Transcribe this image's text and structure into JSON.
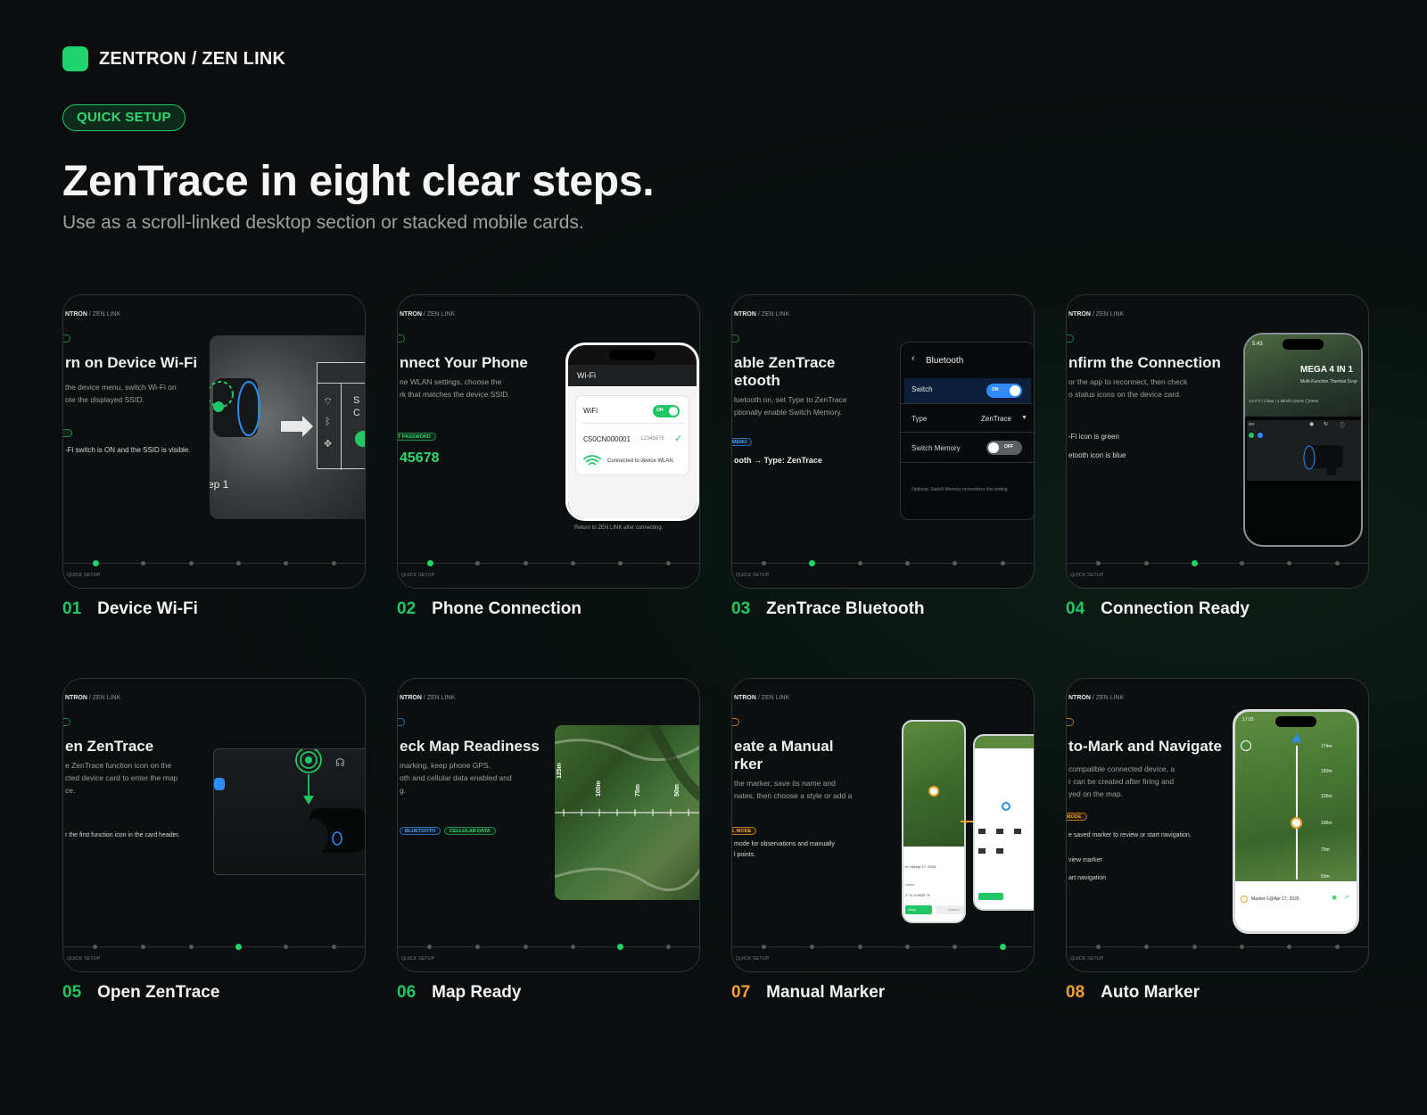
{
  "header": {
    "brand": "ZENTRON / ZEN LINK",
    "pill": "QUICK SETUP",
    "title": "ZenTrace in eight clear steps.",
    "subtitle": "Use as a scroll-linked desktop section or stacked mobile cards."
  },
  "common": {
    "brand_short": "NTRON",
    "brand_link": "/ ZEN LINK",
    "footer": "QUICK SETUP"
  },
  "colors": {
    "accent_green": "#22c765",
    "accent_orange": "#f0a030",
    "bluetooth_blue": "#2f8bf5",
    "background": "#0b0d0e"
  },
  "cards": [
    {
      "num": "01",
      "label": "Device Wi-Fi",
      "active_step": 1,
      "title": "rn on Device Wi-Fi",
      "desc": "the device menu, switch Wi-Fi on\note the displayed SSID.",
      "note": "-Fi switch is ON and the SSID is visible.",
      "panel_text": "ep 1",
      "menu_letters": [
        "S",
        "C"
      ]
    },
    {
      "num": "02",
      "label": "Phone Connection",
      "active_step": 2,
      "title": "nnect Your Phone",
      "desc": "ne WLAN settings, choose the\nrk that matches the device SSID.",
      "tag": "T PASSWORD",
      "password": "45678",
      "phone": {
        "header": "Wi-Fi",
        "wifi_label": "WiFi",
        "toggle": "ON",
        "ssid": "C50CN000001",
        "ssid_code": "12345678",
        "connected": "Connected to device WLAN"
      },
      "note": "Return to ZEN LINK after connecting."
    },
    {
      "num": "03",
      "label": "ZenTrace Bluetooth",
      "active_step": 3,
      "title": "able ZenTrace\netooth",
      "desc": "luetooth on, set Type to ZenTrace\nptionally enable Switch Memory.",
      "tag": "MENU",
      "path_from": "ooth",
      "path_to": "Type: ZenTrace",
      "panel": {
        "header": "Bluetooth",
        "switch_label": "Switch",
        "switch_state": "ON",
        "type_label": "Type",
        "type_value": "ZenTrace",
        "memory_label": "Switch Memory",
        "memory_state": "OFF",
        "footnote": "Optional: Switch Memory remembers this setting."
      }
    },
    {
      "num": "04",
      "label": "Connection Ready",
      "active_step": 4,
      "title": "nfirm the Connection",
      "desc": "or the app to reconnect, then check\no status icons on the device card.",
      "check1": "-Fi icon is green",
      "check2": "etooth icon is blue",
      "phone": {
        "time": "5:43",
        "banner_title": "MEGA 4 IN 1",
        "banner_sub": "Multi-Function Thermal Scop",
        "stats": "14.3°C / Clear   ↑1.2km/h   ◷31%   ◯0mm",
        "device_label": "iev"
      }
    },
    {
      "num": "05",
      "label": "Open ZenTrace",
      "active_step": 5,
      "title": "en ZenTrace",
      "desc": "e ZenTrace function icon on the\ncted device card to enter the map\nce.",
      "note": "r the first function icon in the card header."
    },
    {
      "num": "06",
      "label": "Map Ready",
      "active_step": 6,
      "title": "eck Map Readiness",
      "desc": "marking, keep phone GPS,\noth and cellular data enabled and\ng.",
      "tags": [
        "BLUETOOTH",
        "CELLULAR DATA"
      ],
      "ranges": [
        "125m",
        "100m",
        "75m",
        "50m"
      ]
    },
    {
      "num": "07",
      "label": "Manual Marker",
      "active_step": 7,
      "title": "eate a Manual\nrker",
      "desc": "the marker, save its name and\nnates, then choose a style or add a",
      "tag": "L MODE",
      "note": "mode for observations and manually\nl points.",
      "phone": {
        "marker_date": "er-1@Apr 17, 2026",
        "coords_label": "nates",
        "coords": "2° N, 9.9632° E",
        "save": "Save",
        "cancel": "Cancel"
      }
    },
    {
      "num": "08",
      "label": "Auto Marker",
      "active_step": 8,
      "title": "to-Mark and Navigate",
      "desc": "compatible connected device, a\nr can be created after firing and\nyed on the map.",
      "tag": "MODE",
      "note": "e saved marker to review or start navigation.",
      "option1": "view marker",
      "option2": "art navigation",
      "phone": {
        "time": "17:03",
        "ranges": [
          "174m",
          "150m",
          "125m",
          "100m",
          "75m",
          "50m"
        ],
        "marker": "Marker-1@Apr 17, 2026"
      }
    }
  ]
}
